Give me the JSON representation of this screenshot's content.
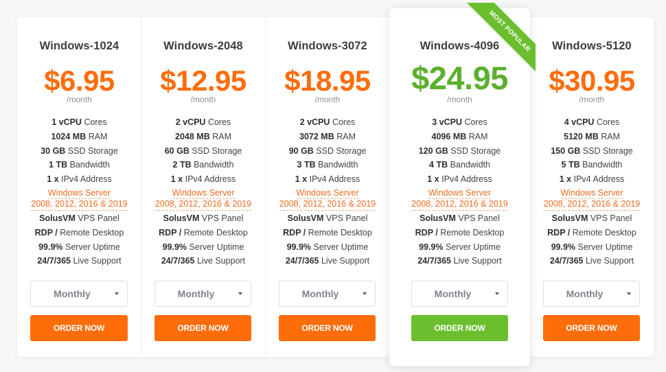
{
  "colors": {
    "accent_orange": "#ff6c0a",
    "accent_green": "#6bbf2f",
    "price_green": "#5bb02c",
    "os_link": "#f06a1f"
  },
  "period_label": "/month",
  "ribbon_label": "MOST POPULAR",
  "plans": [
    {
      "name": "Windows-1024",
      "price": "$6.95",
      "featured": false,
      "features": {
        "cpu": {
          "value": "1 vCPU",
          "label": " Cores"
        },
        "ram": {
          "value": "1024 MB",
          "label": " RAM"
        },
        "storage": {
          "value": "30 GB",
          "label": " SSD Storage"
        },
        "bandwidth": {
          "value": "1 TB",
          "label": " Bandwidth"
        },
        "ip": {
          "value": "1 x",
          "label": " IPv4 Address"
        },
        "os_line1": "Windows Server",
        "os_line2": "2008, 2012, 2016 & 2019",
        "panel": {
          "value": "SolusVM",
          "label": " VPS Panel"
        },
        "rdp": {
          "value": "RDP /",
          "label": " Remote Desktop"
        },
        "uptime": {
          "value": "99.9%",
          "label": " Server Uptime"
        },
        "support": {
          "value": "24/7/365",
          "label": " Live Support"
        }
      },
      "billing_cycle": "Monthly",
      "order_label": "ORDER NOW"
    },
    {
      "name": "Windows-2048",
      "price": "$12.95",
      "featured": false,
      "features": {
        "cpu": {
          "value": "2 vCPU",
          "label": " Cores"
        },
        "ram": {
          "value": "2048 MB",
          "label": " RAM"
        },
        "storage": {
          "value": "60 GB",
          "label": " SSD Storage"
        },
        "bandwidth": {
          "value": "2 TB",
          "label": " Bandwidth"
        },
        "ip": {
          "value": "1 x",
          "label": " IPv4 Address"
        },
        "os_line1": "Windows Server",
        "os_line2": "2008, 2012, 2016 & 2019",
        "panel": {
          "value": "SolusVM",
          "label": " VPS Panel"
        },
        "rdp": {
          "value": "RDP /",
          "label": " Remote Desktop"
        },
        "uptime": {
          "value": "99.9%",
          "label": " Server Uptime"
        },
        "support": {
          "value": "24/7/365",
          "label": " Live Support"
        }
      },
      "billing_cycle": "Monthly",
      "order_label": "ORDER NOW"
    },
    {
      "name": "Windows-3072",
      "price": "$18.95",
      "featured": false,
      "features": {
        "cpu": {
          "value": "2 vCPU",
          "label": " Cores"
        },
        "ram": {
          "value": "3072 MB",
          "label": " RAM"
        },
        "storage": {
          "value": "90 GB",
          "label": " SSD Storage"
        },
        "bandwidth": {
          "value": "3 TB",
          "label": " Bandwidth"
        },
        "ip": {
          "value": "1 x",
          "label": " IPv4 Address"
        },
        "os_line1": "Windows Server",
        "os_line2": "2008, 2012, 2016 & 2019",
        "panel": {
          "value": "SolusVM",
          "label": " VPS Panel"
        },
        "rdp": {
          "value": "RDP /",
          "label": " Remote Desktop"
        },
        "uptime": {
          "value": "99.9%",
          "label": " Server Uptime"
        },
        "support": {
          "value": "24/7/365",
          "label": " Live Support"
        }
      },
      "billing_cycle": "Monthly",
      "order_label": "ORDER NOW"
    },
    {
      "name": "Windows-4096",
      "price": "$24.95",
      "featured": true,
      "features": {
        "cpu": {
          "value": "3 vCPU",
          "label": " Cores"
        },
        "ram": {
          "value": "4096 MB",
          "label": " RAM"
        },
        "storage": {
          "value": "120 GB",
          "label": " SSD Storage"
        },
        "bandwidth": {
          "value": "4 TB",
          "label": " Bandwidth"
        },
        "ip": {
          "value": "1 x",
          "label": " IPv4 Address"
        },
        "os_line1": "Windows Server",
        "os_line2": "2008, 2012, 2016 & 2019",
        "panel": {
          "value": "SolusVM",
          "label": " VPS Panel"
        },
        "rdp": {
          "value": "RDP /",
          "label": " Remote Desktop"
        },
        "uptime": {
          "value": "99.9%",
          "label": " Server Uptime"
        },
        "support": {
          "value": "24/7/365",
          "label": " Live Support"
        }
      },
      "billing_cycle": "Monthly",
      "order_label": "ORDER NOW"
    },
    {
      "name": "Windows-5120",
      "price": "$30.95",
      "featured": false,
      "features": {
        "cpu": {
          "value": "4 vCPU",
          "label": " Cores"
        },
        "ram": {
          "value": "5120 MB",
          "label": " RAM"
        },
        "storage": {
          "value": "150 GB",
          "label": " SSD Storage"
        },
        "bandwidth": {
          "value": "5 TB",
          "label": " Bandwidth"
        },
        "ip": {
          "value": "1 x",
          "label": " IPv4 Address"
        },
        "os_line1": "Windows Server",
        "os_line2": "2008, 2012, 2016 & 2019",
        "panel": {
          "value": "SolusVM",
          "label": " VPS Panel"
        },
        "rdp": {
          "value": "RDP /",
          "label": " Remote Desktop"
        },
        "uptime": {
          "value": "99.9%",
          "label": " Server Uptime"
        },
        "support": {
          "value": "24/7/365",
          "label": " Live Support"
        }
      },
      "billing_cycle": "Monthly",
      "order_label": "ORDER NOW"
    }
  ]
}
